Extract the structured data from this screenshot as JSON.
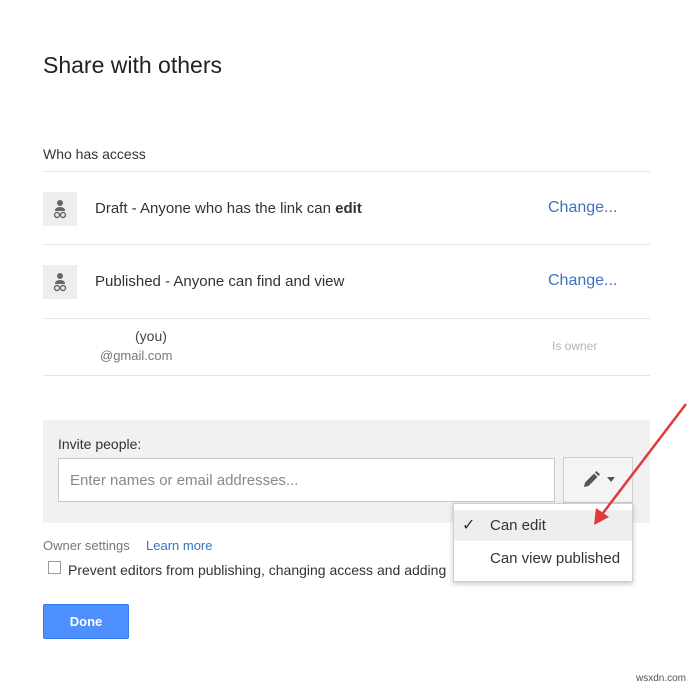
{
  "dialog": {
    "title": "Share with others",
    "who_has_access_label": "Who has access"
  },
  "access_list": [
    {
      "icon": "person-icon",
      "text_prefix": "Draft - Anyone who has the link can ",
      "text_bold": "edit",
      "action": "Change..."
    },
    {
      "icon": "person-icon",
      "text_prefix": "Published - Anyone can find and view",
      "text_bold": "",
      "action": "Change..."
    }
  ],
  "owner": {
    "name_suffix": "(you)",
    "email": "@gmail.com",
    "role": "Is owner"
  },
  "invite": {
    "label": "Invite people:",
    "placeholder": "Enter names or email addresses...",
    "permission_icon": "pencil-icon"
  },
  "permission_menu": {
    "items": [
      {
        "label": "Can edit",
        "checked": true
      },
      {
        "label": "Can view published",
        "checked": false
      }
    ],
    "check_glyph": "✓"
  },
  "owner_settings": {
    "label": "Owner settings",
    "learn_more": "Learn more",
    "prevent_label": "Prevent editors from publishing, changing access and adding"
  },
  "done_label": "Done",
  "annotation": {
    "arrow_color": "#e03a3a"
  },
  "colors": {
    "link": "#3b73c5",
    "primary_button": "#4d90fe"
  },
  "watermark": "wsxdn.com"
}
